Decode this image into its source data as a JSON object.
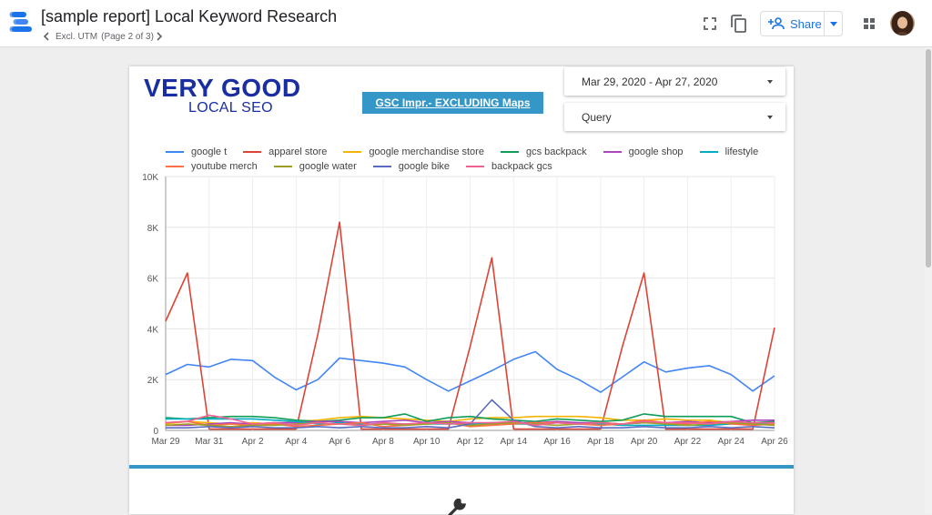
{
  "header": {
    "title": "[sample report] Local Keyword Research",
    "page_name": "Excl. UTM",
    "page_indicator": "(Page 2 of 3)",
    "share_label": "Share"
  },
  "report": {
    "brand_line1": "VERY GOOD",
    "brand_line2": "LOCAL SEO",
    "section_title": "GSC Impr.- EXCLUDING Maps",
    "date_range": "Mar 29, 2020 - Apr 27, 2020",
    "dimension_filter": "Query"
  },
  "colors": {
    "brand_blue": "#1a2ea3",
    "accent": "#3597c8",
    "share_blue": "#1a73e8"
  },
  "chart_data": {
    "type": "line",
    "ylim": [
      0,
      10000
    ],
    "y_ticks": [
      0,
      2000,
      4000,
      6000,
      8000,
      10000
    ],
    "y_tick_labels": [
      "0",
      "2K",
      "4K",
      "6K",
      "8K",
      "10K"
    ],
    "x_tick_labels": [
      "Mar 29",
      "Mar 31",
      "Apr 2",
      "Apr 4",
      "Apr 6",
      "Apr 8",
      "Apr 10",
      "Apr 12",
      "Apr 14",
      "Apr 16",
      "Apr 18",
      "Apr 20",
      "Apr 22",
      "Apr 24",
      "Apr 26"
    ],
    "x": [
      "Mar 29",
      "Mar 30",
      "Mar 31",
      "Apr 1",
      "Apr 2",
      "Apr 3",
      "Apr 4",
      "Apr 5",
      "Apr 6",
      "Apr 7",
      "Apr 8",
      "Apr 9",
      "Apr 10",
      "Apr 11",
      "Apr 12",
      "Apr 13",
      "Apr 14",
      "Apr 15",
      "Apr 16",
      "Apr 17",
      "Apr 18",
      "Apr 19",
      "Apr 20",
      "Apr 21",
      "Apr 22",
      "Apr 23",
      "Apr 24",
      "Apr 25",
      "Apr 26"
    ],
    "legend_position": "top",
    "grid": true,
    "series": [
      {
        "name": "google t",
        "color": "#4285f4",
        "values": [
          2200,
          2600,
          2500,
          2800,
          2750,
          2100,
          1600,
          2000,
          2850,
          2750,
          2650,
          2500,
          2000,
          1550,
          1950,
          2350,
          2800,
          3100,
          2400,
          2000,
          1500,
          2100,
          2700,
          2300,
          2450,
          2550,
          2200,
          1550,
          2150
        ]
      },
      {
        "name": "apparel store",
        "color": "#db4437",
        "values": [
          4300,
          6200,
          50,
          50,
          50,
          50,
          50,
          3800,
          8200,
          50,
          50,
          50,
          50,
          50,
          3300,
          6800,
          50,
          50,
          50,
          50,
          50,
          3300,
          6200,
          50,
          50,
          50,
          50,
          50,
          4050
        ]
      },
      {
        "name": "google merchandise store",
        "color": "#f4b400",
        "values": [
          250,
          350,
          300,
          250,
          300,
          250,
          350,
          400,
          500,
          550,
          500,
          450,
          400,
          350,
          450,
          500,
          500,
          550,
          550,
          550,
          500,
          400,
          400,
          450,
          400,
          400,
          300,
          250,
          250
        ]
      },
      {
        "name": "gcs backpack",
        "color": "#0f9d58",
        "values": [
          500,
          450,
          500,
          550,
          550,
          500,
          400,
          350,
          400,
          500,
          500,
          650,
          350,
          500,
          550,
          450,
          400,
          350,
          450,
          400,
          350,
          400,
          650,
          550,
          550,
          550,
          550,
          300,
          350
        ]
      },
      {
        "name": "google shop",
        "color": "#ab47bc",
        "values": [
          200,
          200,
          250,
          300,
          250,
          300,
          300,
          350,
          350,
          300,
          350,
          400,
          300,
          350,
          300,
          250,
          300,
          300,
          350,
          300,
          300,
          250,
          300,
          300,
          350,
          300,
          350,
          400,
          400
        ]
      },
      {
        "name": "lifestyle",
        "color": "#00acc1",
        "values": [
          450,
          450,
          450,
          450,
          450,
          400,
          350,
          250,
          300,
          250,
          250,
          250,
          250,
          250,
          250,
          300,
          250,
          250,
          300,
          250,
          250,
          200,
          200,
          200,
          200,
          200,
          250,
          250,
          250
        ]
      },
      {
        "name": "youtube merch",
        "color": "#ff7043",
        "values": [
          300,
          350,
          200,
          250,
          200,
          250,
          150,
          200,
          250,
          300,
          150,
          200,
          250,
          300,
          150,
          200,
          250,
          300,
          300,
          250,
          200,
          250,
          400,
          300,
          250,
          350,
          250,
          200,
          250
        ]
      },
      {
        "name": "google water",
        "color": "#9e9d24",
        "values": [
          200,
          250,
          200,
          150,
          200,
          200,
          250,
          300,
          250,
          200,
          250,
          200,
          250,
          300,
          200,
          250,
          300,
          250,
          200,
          250,
          300,
          250,
          300,
          250,
          200,
          250,
          300,
          250,
          200
        ]
      },
      {
        "name": "google bike",
        "color": "#5c6bc0",
        "values": [
          100,
          100,
          150,
          100,
          150,
          100,
          100,
          150,
          100,
          150,
          100,
          100,
          150,
          100,
          250,
          1200,
          400,
          150,
          100,
          150,
          100,
          100,
          150,
          100,
          100,
          150,
          100,
          150,
          100
        ]
      },
      {
        "name": "backpack gcs",
        "color": "#f06292",
        "values": [
          300,
          350,
          600,
          450,
          250,
          300,
          200,
          300,
          250,
          200,
          300,
          250,
          300,
          250,
          300,
          300,
          350,
          200,
          300,
          250,
          300,
          250,
          350,
          300,
          300,
          250,
          350,
          300,
          300
        ]
      }
    ]
  }
}
